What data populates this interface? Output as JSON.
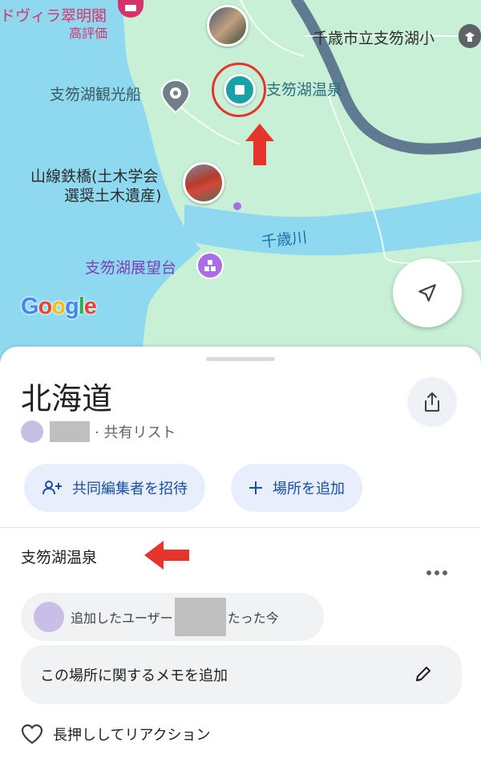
{
  "map": {
    "pois": {
      "hotel_top_line": "ドヴィラ翠明閣",
      "hotel_rating": "高評価",
      "school": "千歳市立支笏湖小",
      "boat": "支笏湖観光船",
      "onsen": "支笏湖温泉",
      "bridge_line1": "山線鉄橋(土木学会",
      "bridge_line2": "選奨土木遺産)",
      "river": "千歳川",
      "lookout": "支笏湖展望台"
    },
    "logo": [
      "G",
      "o",
      "o",
      "g",
      "l",
      "e"
    ],
    "colors": {
      "land": "#c8f0d6",
      "water": "#8ed9f0",
      "road": "#5f7a91",
      "selected": "#1aa1a8",
      "highlight_ring": "#e5352b"
    }
  },
  "list": {
    "title": "北海道",
    "shared_label": "· 共有リスト",
    "invite_label": "共同編集者を招待",
    "add_place_label": "場所を追加"
  },
  "place": {
    "name": "支笏湖温泉",
    "added_by_prefix": "追加したユーザー",
    "added_time": "たった今",
    "memo_placeholder": "この場所に関するメモを追加",
    "reaction_label": "長押ししてリアクション"
  }
}
